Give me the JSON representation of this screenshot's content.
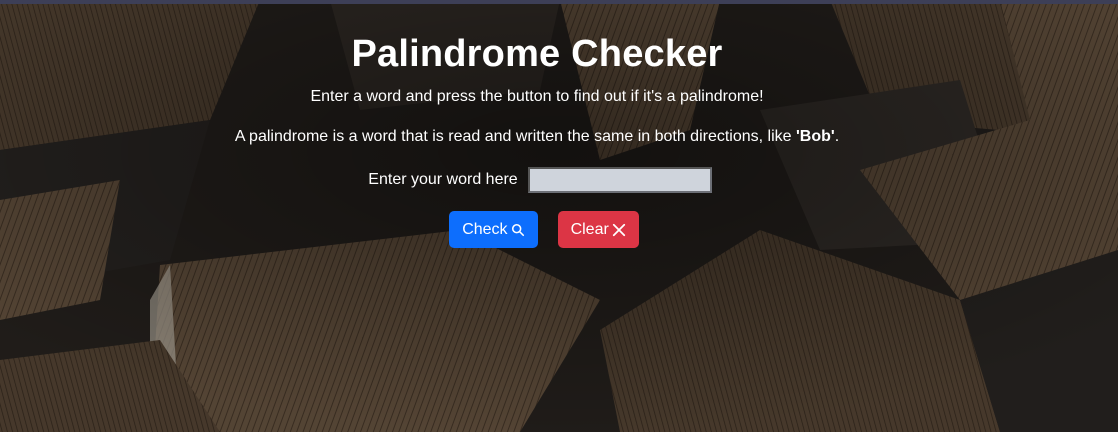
{
  "page": {
    "title": "Palindrome Checker",
    "intro": "Enter a word and press the button to find out if it's a palindrome!",
    "definition_prefix": "A palindrome is a word that is read and written the same in both directions, like ",
    "definition_example": "'Bob'",
    "definition_suffix": "."
  },
  "form": {
    "label": "Enter your word here",
    "input_value": "",
    "input_placeholder": ""
  },
  "buttons": {
    "check_label": "Check",
    "check_icon": "search-icon",
    "clear_label": "Clear",
    "clear_icon": "close-icon"
  },
  "colors": {
    "check_button": "#0d6efd",
    "clear_button": "#dc3545",
    "text": "#ffffff",
    "input_background": "#cfd4dc"
  }
}
